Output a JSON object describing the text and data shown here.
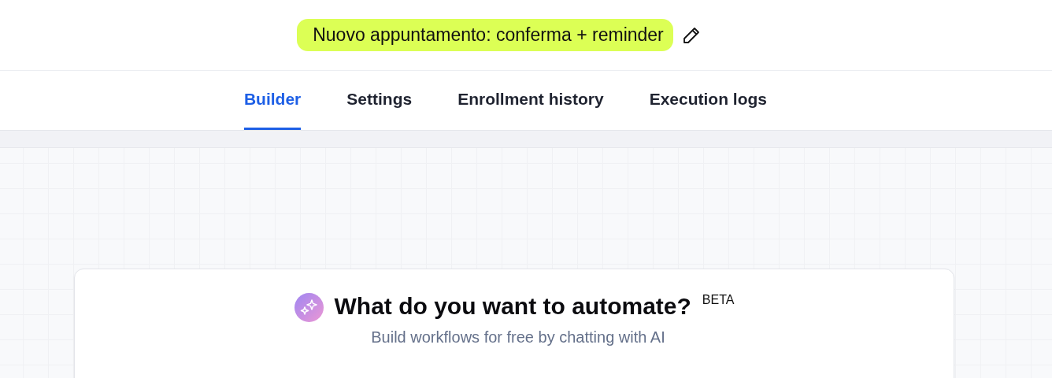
{
  "workflow": {
    "title": "Nuovo appuntamento: conferma + reminder"
  },
  "tabs": [
    {
      "label": "Builder",
      "selected": true
    },
    {
      "label": "Settings",
      "selected": false
    },
    {
      "label": "Enrollment history",
      "selected": false
    },
    {
      "label": "Execution logs",
      "selected": false
    }
  ],
  "ai_prompt": {
    "heading": "What do you want to automate?",
    "badge": "BETA",
    "subtitle": "Build workflows for free by chatting with AI"
  }
}
